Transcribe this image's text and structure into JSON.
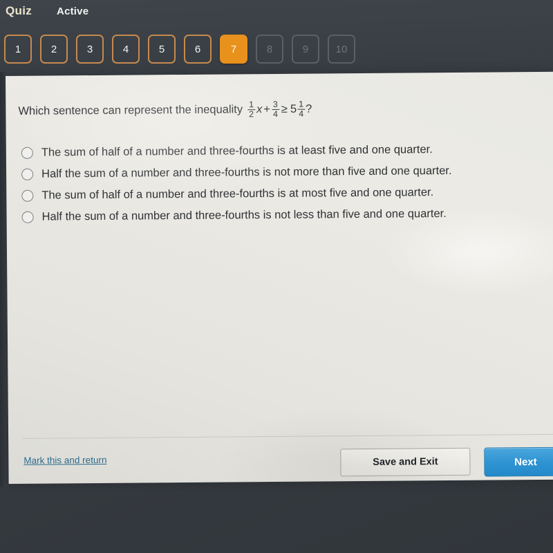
{
  "header": {
    "quiz_label": "Quiz",
    "status_label": "Active",
    "nav_buttons": [
      {
        "label": "1",
        "state": "answered"
      },
      {
        "label": "2",
        "state": "answered"
      },
      {
        "label": "3",
        "state": "answered"
      },
      {
        "label": "4",
        "state": "answered"
      },
      {
        "label": "5",
        "state": "answered"
      },
      {
        "label": "6",
        "state": "answered"
      },
      {
        "label": "7",
        "state": "active"
      },
      {
        "label": "8",
        "state": "locked"
      },
      {
        "label": "9",
        "state": "locked"
      },
      {
        "label": "10",
        "state": "locked"
      }
    ],
    "colors": {
      "background": "#3a4046",
      "active_button": "#e8911c",
      "answered_border": "#c78a4e",
      "locked_border": "#5a6066",
      "quiz_text": "#ece5cd",
      "status_text": "#f3f3f1"
    }
  },
  "question": {
    "stem_text": "Which sentence can represent the inequality",
    "inequality": {
      "coefficient": {
        "numerator": "1",
        "denominator": "2"
      },
      "variable": "x",
      "operator": "+",
      "constant": {
        "numerator": "3",
        "denominator": "4"
      },
      "relation": "≥",
      "right_whole": "5",
      "right_fraction": {
        "numerator": "1",
        "denominator": "4"
      },
      "trailing": "?",
      "plain_text": "1/2 x + 3/4 ≥ 5 1/4 ?"
    },
    "options": [
      {
        "label": "The sum of half of a number and three-fourths is at least five and one quarter.",
        "selected": false
      },
      {
        "label": "Half the sum of a number and three-fourths is not more than five and one quarter.",
        "selected": false
      },
      {
        "label": "The sum of half of a number and three-fourths is at most five and one quarter.",
        "selected": false
      },
      {
        "label": "Half the sum of a number and three-fourths is not less than five and one quarter.",
        "selected": false
      }
    ]
  },
  "footer": {
    "mark_return_label": "Mark this and return",
    "save_exit_label": "Save and Exit",
    "next_label": "Next",
    "colors": {
      "link": "#2b6b8c",
      "next_button": "#2f94d2",
      "card_background": "#eceae4"
    }
  }
}
